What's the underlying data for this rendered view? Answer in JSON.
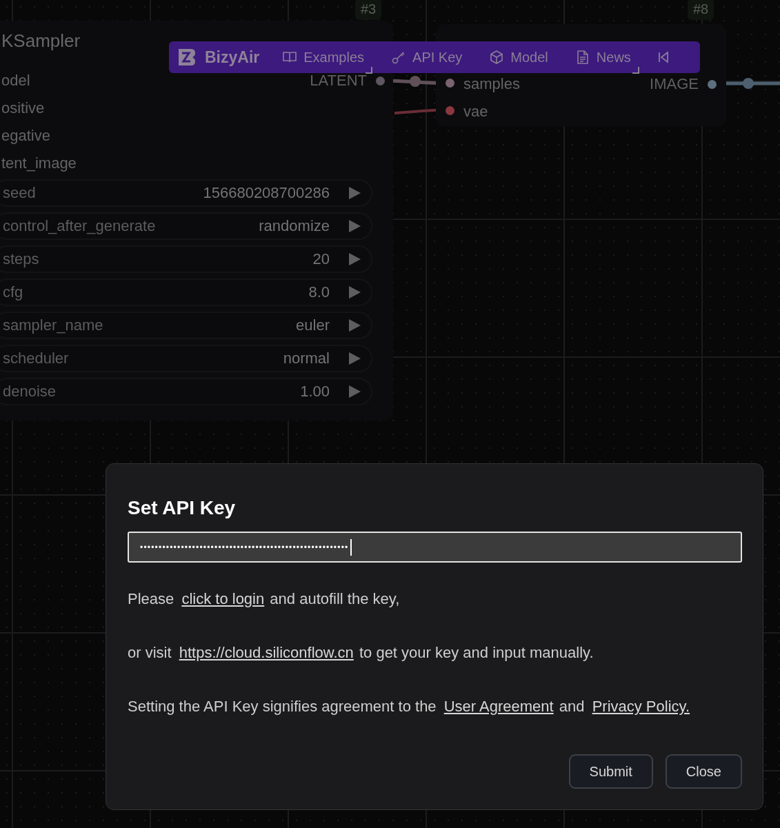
{
  "canvas": {
    "badges": [
      {
        "label": "#3"
      },
      {
        "label": "#8"
      }
    ],
    "ksampler": {
      "title": "KSampler",
      "inputs": [
        {
          "label": "odel"
        },
        {
          "label": "ositive"
        },
        {
          "label": "egative"
        },
        {
          "label": "tent_image"
        }
      ],
      "output": {
        "label": "LATENT"
      },
      "widgets": [
        {
          "label": "seed",
          "value": "156680208700286"
        },
        {
          "label": "control_after_generate",
          "value": "randomize"
        },
        {
          "label": "steps",
          "value": "20"
        },
        {
          "label": "cfg",
          "value": "8.0"
        },
        {
          "label": "sampler_name",
          "value": "euler"
        },
        {
          "label": "scheduler",
          "value": "normal"
        },
        {
          "label": "denoise",
          "value": "1.00"
        }
      ]
    },
    "vae_decode": {
      "inputs": [
        {
          "label": "samples",
          "color": "#7a6470"
        },
        {
          "label": "vae",
          "color": "#8a3840"
        }
      ],
      "output": {
        "label": "IMAGE",
        "color": "#5e7080"
      }
    }
  },
  "toolbar": {
    "brand": "BizyAir",
    "items": [
      {
        "label": "Examples",
        "kind": "book",
        "corner": true
      },
      {
        "label": "API Key",
        "kind": "key",
        "corner": false
      },
      {
        "label": "Model",
        "kind": "cube",
        "corner": false
      },
      {
        "label": "News",
        "kind": "document",
        "corner": true
      }
    ]
  },
  "dialog": {
    "title": "Set API Key",
    "field": {
      "value": "••••••••••••••••••••••••••••••••••••••••••••••••••••••••"
    },
    "paragraphs": [
      [
        {
          "kind": "text",
          "text": "Please "
        },
        {
          "kind": "link",
          "text": "click to login"
        },
        {
          "kind": "text",
          "text": " and autofill the key,"
        }
      ],
      [
        {
          "kind": "text",
          "text": "or visit "
        },
        {
          "kind": "link",
          "text": "https://cloud.siliconflow.cn"
        },
        {
          "kind": "text",
          "text": " to get your key and input manually."
        }
      ],
      [
        {
          "kind": "text",
          "text": "Setting the API Key signifies agreement to the "
        },
        {
          "kind": "link",
          "text": "User Agreement"
        },
        {
          "kind": "text",
          "text": " and "
        },
        {
          "kind": "link",
          "text": "Privacy Policy."
        }
      ]
    ],
    "buttons": [
      "Submit",
      "Close"
    ]
  }
}
